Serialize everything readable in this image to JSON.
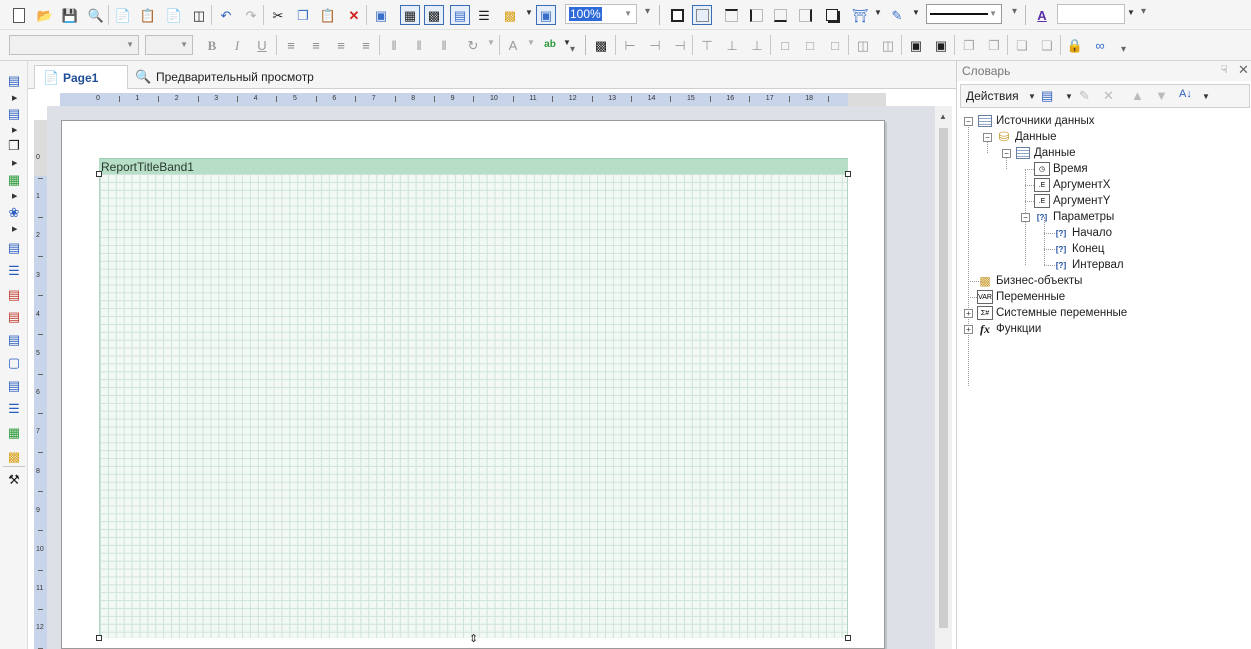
{
  "toolbar": {
    "zoom_value": "100%",
    "font_name_placeholder": "",
    "font_size_placeholder": "",
    "style_combo_value": ""
  },
  "tabs": [
    {
      "label": "Page1",
      "active": true
    },
    {
      "label": "Предварительный просмотр",
      "active": false
    }
  ],
  "rulers": {
    "horizontal": [
      "0",
      "1",
      "2",
      "3",
      "4",
      "5",
      "6",
      "7",
      "8",
      "9",
      "10",
      "11",
      "12",
      "13",
      "14",
      "15",
      "16",
      "17",
      "18"
    ],
    "vertical": [
      "0",
      "1",
      "2",
      "3",
      "4",
      "5",
      "6",
      "7",
      "8",
      "9",
      "10",
      "11",
      "12"
    ]
  },
  "report": {
    "band_label": "ReportTitleBand1"
  },
  "dictionary": {
    "title": "Словарь",
    "actions_label": "Действия",
    "tree": {
      "data_sources": "Источники данных",
      "data_connection": "Данные",
      "data_table": "Данные",
      "fields": [
        "Время",
        "АргументX",
        "АргументY"
      ],
      "parameters": "Параметры",
      "params": [
        "Начало",
        "Конец",
        "Интервал"
      ],
      "business_objects": "Бизнес-объекты",
      "variables": "Переменные",
      "system_variables": "Системные переменные",
      "functions": "Функции"
    }
  },
  "colors": {
    "band": "#b7dfc8",
    "grid_bg": "#f2f9f5",
    "ruler_active": "#c8d4ea",
    "design_bg": "#dde1e7",
    "tab_active_text": "#1f4e96"
  }
}
